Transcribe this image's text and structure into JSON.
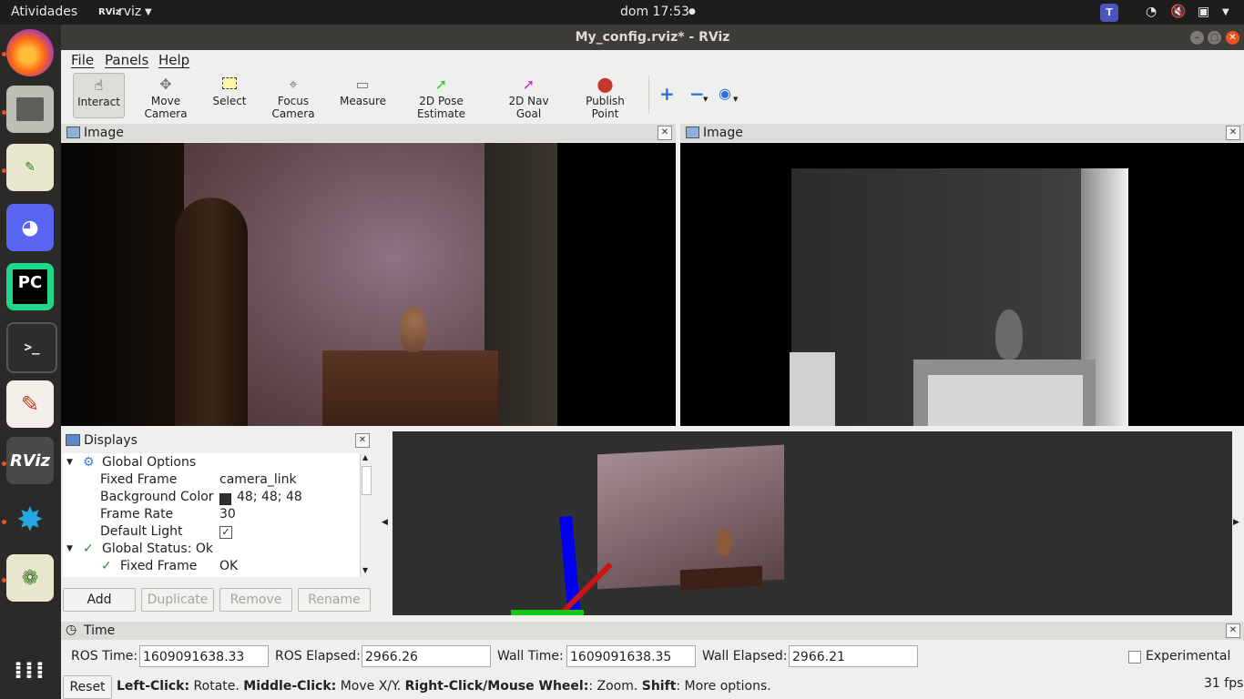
{
  "topbar": {
    "activities": "Atividades",
    "app_name": "rviz",
    "clock": "dom 17:53"
  },
  "window": {
    "title": "My_config.rviz* - RViz"
  },
  "menubar": {
    "items": [
      "File",
      "Panels",
      "Help"
    ]
  },
  "toolbar": {
    "tools": [
      "Interact",
      "Move Camera",
      "Select",
      "Focus Camera",
      "Measure",
      "2D Pose Estimate",
      "2D Nav Goal",
      "Publish Point"
    ],
    "active": "Interact"
  },
  "image_panels": {
    "left_title": "Image",
    "right_title": "Image"
  },
  "displays": {
    "title": "Displays",
    "rows": [
      {
        "label": "Global Options",
        "value": ""
      },
      {
        "label": "Fixed Frame",
        "value": "camera_link"
      },
      {
        "label": "Background Color",
        "value": "48; 48; 48"
      },
      {
        "label": "Frame Rate",
        "value": "30"
      },
      {
        "label": "Default Light",
        "value": ""
      },
      {
        "label": "Global Status: Ok",
        "value": ""
      },
      {
        "label": "Fixed Frame",
        "value": "OK"
      }
    ],
    "buttons": {
      "add": "Add",
      "duplicate": "Duplicate",
      "remove": "Remove",
      "rename": "Rename"
    }
  },
  "time": {
    "title": "Time",
    "ros_time_label": "ROS Time:",
    "ros_time": "1609091638.33",
    "ros_elapsed_label": "ROS Elapsed:",
    "ros_elapsed": "2966.26",
    "wall_time_label": "Wall Time:",
    "wall_time": "1609091638.35",
    "wall_elapsed_label": "Wall Elapsed:",
    "wall_elapsed": "2966.21",
    "experimental": "Experimental"
  },
  "statusbar": {
    "reset": "Reset",
    "hint_b1": "Left-Click:",
    "hint_t1": " Rotate. ",
    "hint_b2": "Middle-Click:",
    "hint_t2": " Move X/Y. ",
    "hint_b3": "Right-Click/Mouse Wheel:",
    "hint_t3": ": Zoom. ",
    "hint_b4": "Shift",
    "hint_t4": ": More options.",
    "fps": "31 fps"
  },
  "colors": {
    "background": "#303030",
    "accent": "#e95420"
  }
}
